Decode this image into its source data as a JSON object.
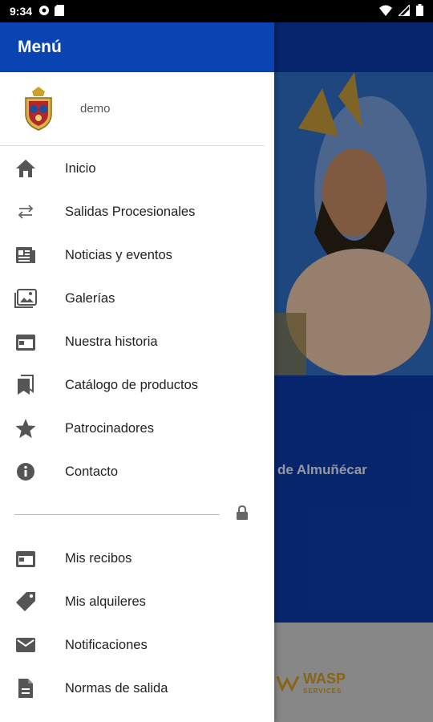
{
  "status_bar": {
    "time": "9:34",
    "icons": [
      "settings-icon",
      "sd-card-icon",
      "wifi-icon",
      "signal-icon",
      "battery-icon"
    ]
  },
  "drawer": {
    "title": "Menú",
    "profile": {
      "name": "demo"
    },
    "items": [
      {
        "label": "Inicio",
        "icon": "home-icon"
      },
      {
        "label": "Salidas Procesionales",
        "icon": "swap-icon"
      },
      {
        "label": "Noticias y eventos",
        "icon": "newspaper-icon"
      },
      {
        "label": "Galerías",
        "icon": "gallery-icon"
      },
      {
        "label": "Nuestra historia",
        "icon": "calendar-icon"
      },
      {
        "label": "Catálogo de productos",
        "icon": "bookmark-icon"
      },
      {
        "label": "Patrocinadores",
        "icon": "star-icon"
      },
      {
        "label": "Contacto",
        "icon": "info-icon"
      }
    ],
    "private_items": [
      {
        "label": "Mis recibos",
        "icon": "receipt-icon"
      },
      {
        "label": "Mis alquileres",
        "icon": "tag-icon"
      },
      {
        "label": "Notificaciones",
        "icon": "mail-icon"
      },
      {
        "label": "Normas de salida",
        "icon": "document-icon"
      }
    ]
  },
  "background": {
    "caption": "de Almuñécar",
    "footer_logo": "WASP",
    "footer_logo_sub": "SERVICES"
  },
  "colors": {
    "primary": "#0a44b3",
    "icon": "#555555"
  }
}
